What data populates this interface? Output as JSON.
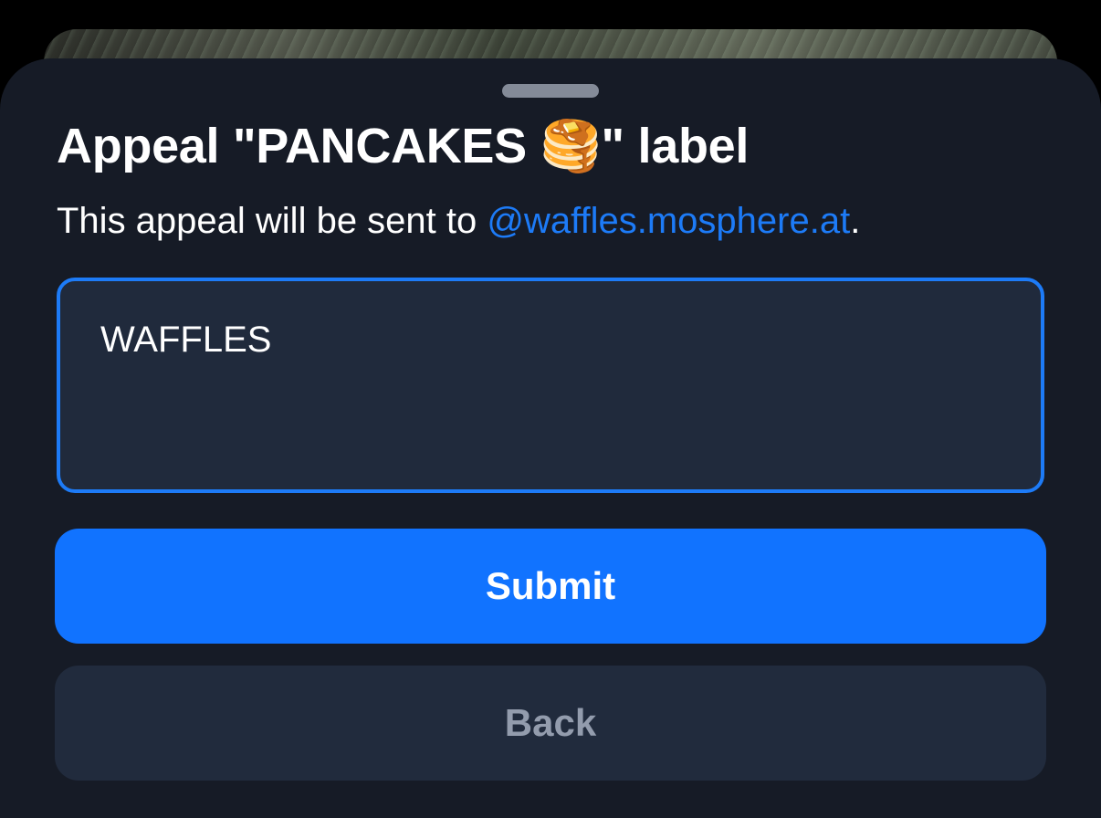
{
  "dialog": {
    "title": "Appeal \"PANCAKES 🥞\" label",
    "subtitle_prefix": "This appeal will be sent to ",
    "subtitle_handle": "@waffles.mosphere.at",
    "subtitle_suffix": ".",
    "textarea_value": "WAFFLES",
    "submit_label": "Submit",
    "back_label": "Back"
  },
  "colors": {
    "accent": "#1173ff",
    "link": "#1d7bf7",
    "sheet_background": "#161b26",
    "field_background": "#202a3c"
  }
}
